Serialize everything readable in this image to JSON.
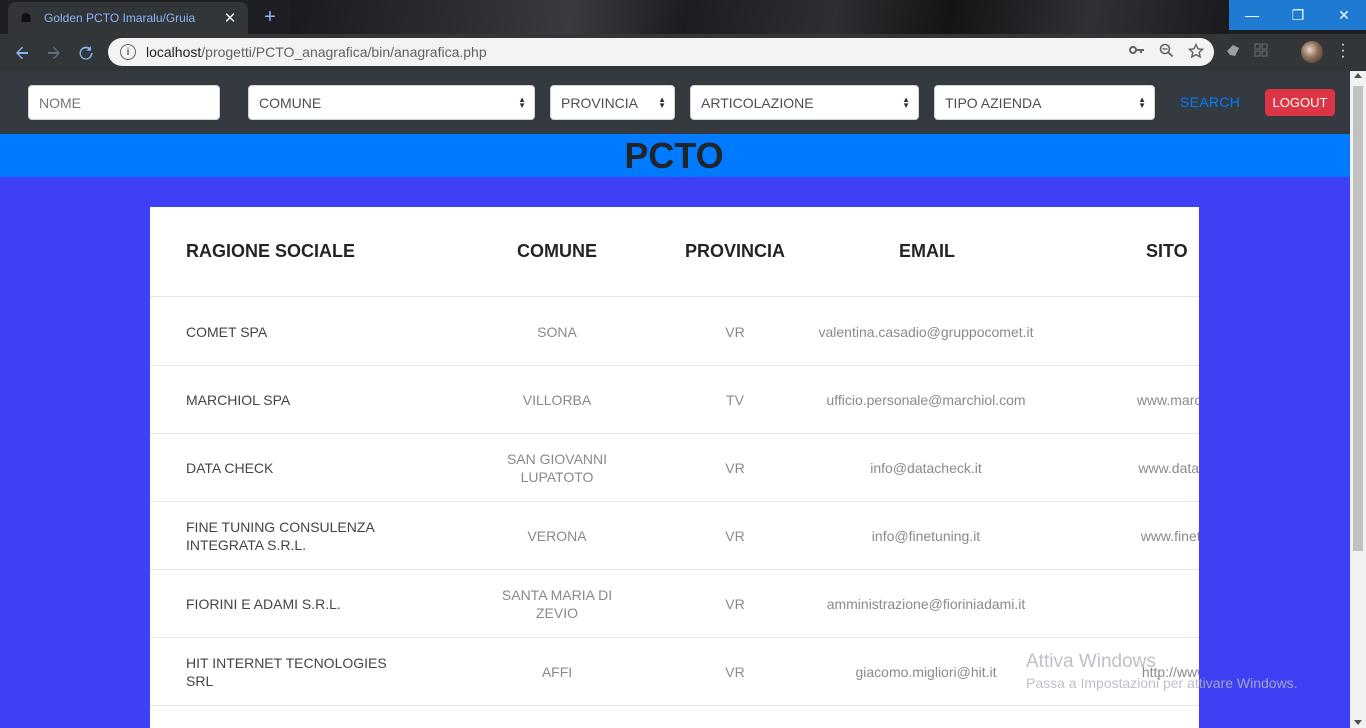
{
  "browser": {
    "tab_title": "Golden PCTO Imaralu/Gruia",
    "tab_close": "✕",
    "new_tab": "+",
    "url_host": "localhost",
    "url_path": "/progetti/PCTO_anagrafica/bin/anagrafica.php",
    "win_minimize": "—",
    "win_restore": "❐",
    "win_close": "✕",
    "icons": {
      "back": "back-arrow-icon",
      "forward": "forward-arrow-icon",
      "reload": "reload-icon",
      "info": "info-icon",
      "key": "key-icon",
      "zoom": "zoom-icon",
      "star": "star-icon"
    }
  },
  "filters": {
    "nome_placeholder": "NOME",
    "comune": "COMUNE",
    "provincia": "PROVINCIA",
    "articolazione": "ARTICOLAZIONE",
    "tipo_azienda": "TIPO AZIENDA",
    "search_label": "SEARCH",
    "logout_label": "LOGOUT"
  },
  "banner": {
    "title": "PCTO"
  },
  "table": {
    "headers": {
      "ragione_sociale": "RAGIONE SOCIALE",
      "comune": "COMUNE",
      "provincia": "PROVINCIA",
      "email": "EMAIL",
      "sito": "SITO"
    },
    "rows": [
      {
        "ragione_sociale": "COMET SPA",
        "comune": "SONA",
        "provincia": "VR",
        "email": "valentina.casadio@gruppocomet.it",
        "sito": ""
      },
      {
        "ragione_sociale": "MARCHIOL SPA",
        "comune": "VILLORBA",
        "provincia": "TV",
        "email": "ufficio.personale@marchiol.com",
        "sito": "www.marchiol"
      },
      {
        "ragione_sociale": "DATA CHECK",
        "comune": "SAN GIOVANNI LUPATOTO",
        "provincia": "VR",
        "email": "info@datacheck.it",
        "sito": "www.datache"
      },
      {
        "ragione_sociale": "FINE TUNING CONSULENZA INTEGRATA S.R.L.",
        "comune": "VERONA",
        "provincia": "VR",
        "email": "info@finetuning.it",
        "sito": "www.finetuni"
      },
      {
        "ragione_sociale": "FIORINI E ADAMI S.R.L.",
        "comune": "SANTA MARIA DI ZEVIO",
        "provincia": "VR",
        "email": "amministrazione@fioriniadami.it",
        "sito": ""
      },
      {
        "ragione_sociale": "HIT INTERNET TECNOLOGIES SRL",
        "comune": "AFFI",
        "provincia": "VR",
        "email": "giacomo.migliori@hit.it",
        "sito": "http://www.h"
      }
    ]
  },
  "watermark": {
    "title": "Attiva Windows",
    "subtitle": "Passa a Impostazioni per attivare Windows."
  }
}
